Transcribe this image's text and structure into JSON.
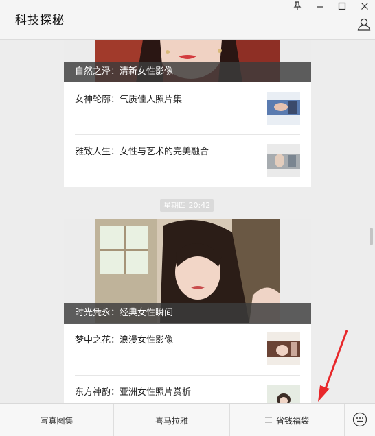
{
  "window": {
    "title": "科技探秘"
  },
  "icons": {
    "pin": "pin-icon",
    "minimize": "minimize-icon",
    "maximize": "maximize-icon",
    "close": "close-icon",
    "user": "user-icon",
    "keyboard": "keyboard-icon",
    "menu": "hamburger-icon"
  },
  "feed": {
    "card1": {
      "cover_caption": "自然之泽：清新女性影像",
      "items": [
        {
          "title": "女神轮廓：气质佳人照片集"
        },
        {
          "title": "雅致人生：女性与艺术的完美融合"
        }
      ]
    },
    "timestamp": "星期四 20:42",
    "card2": {
      "cover_caption": "时光凭永：经典女性瞬间",
      "items": [
        {
          "title": "梦中之花：浪漫女性影像"
        },
        {
          "title": "东方神韵：亚洲女性照片赏析"
        }
      ]
    }
  },
  "bottom_menu": {
    "item1": "写真图集",
    "item2": "喜马拉雅",
    "item3": "省钱福袋"
  },
  "colors": {
    "background": "#ededed",
    "caption_bg": "#3c3c3c",
    "arrow": "#e8272a"
  }
}
